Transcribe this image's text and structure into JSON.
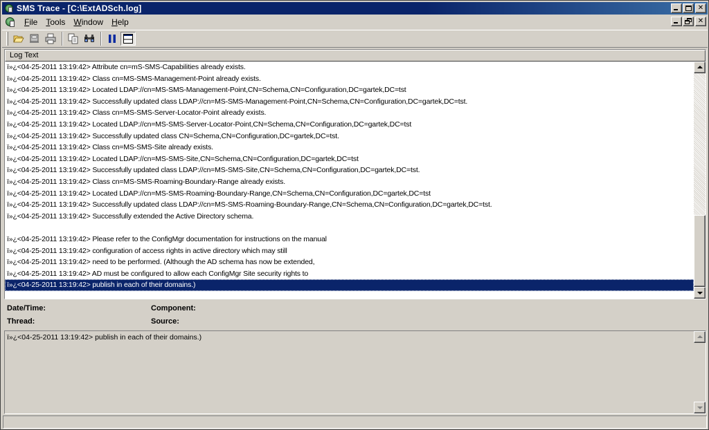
{
  "window": {
    "title": "SMS Trace - [C:\\ExtADSch.log]"
  },
  "menu": {
    "items": [
      {
        "label": "File",
        "accel": "F",
        "rest": "ile"
      },
      {
        "label": "Tools",
        "accel": "T",
        "rest": "ools"
      },
      {
        "label": "Window",
        "accel": "W",
        "rest": "indow"
      },
      {
        "label": "Help",
        "accel": "H",
        "rest": "elp"
      }
    ]
  },
  "toolbar": {
    "buttons": [
      "open-icon",
      "print-preview-icon",
      "print-icon",
      "copy-icon",
      "find-icon",
      "pause-icon",
      "detail-pane-icon"
    ]
  },
  "log": {
    "column_header": "Log Text",
    "rows": [
      "ï»¿<04-25-2011 13:19:42> Attribute cn=mS-SMS-Capabilities already exists.",
      "ï»¿<04-25-2011 13:19:42> Class cn=MS-SMS-Management-Point already exists.",
      "ï»¿<04-25-2011 13:19:42> Located LDAP://cn=MS-SMS-Management-Point,CN=Schema,CN=Configuration,DC=gartek,DC=tst",
      "ï»¿<04-25-2011 13:19:42> Successfully updated class LDAP://cn=MS-SMS-Management-Point,CN=Schema,CN=Configuration,DC=gartek,DC=tst.",
      "ï»¿<04-25-2011 13:19:42> Class cn=MS-SMS-Server-Locator-Point already exists.",
      "ï»¿<04-25-2011 13:19:42> Located LDAP://cn=MS-SMS-Server-Locator-Point,CN=Schema,CN=Configuration,DC=gartek,DC=tst",
      "ï»¿<04-25-2011 13:19:42> Successfully updated class CN=Schema,CN=Configuration,DC=gartek,DC=tst.",
      "ï»¿<04-25-2011 13:19:42> Class cn=MS-SMS-Site already exists.",
      "ï»¿<04-25-2011 13:19:42> Located LDAP://cn=MS-SMS-Site,CN=Schema,CN=Configuration,DC=gartek,DC=tst",
      "ï»¿<04-25-2011 13:19:42> Successfully updated class LDAP://cn=MS-SMS-Site,CN=Schema,CN=Configuration,DC=gartek,DC=tst.",
      "ï»¿<04-25-2011 13:19:42> Class cn=MS-SMS-Roaming-Boundary-Range already exists.",
      "ï»¿<04-25-2011 13:19:42> Located LDAP://cn=MS-SMS-Roaming-Boundary-Range,CN=Schema,CN=Configuration,DC=gartek,DC=tst",
      "ï»¿<04-25-2011 13:19:42> Successfully updated class LDAP://cn=MS-SMS-Roaming-Boundary-Range,CN=Schema,CN=Configuration,DC=gartek,DC=tst.",
      "ï»¿<04-25-2011 13:19:42> Successfully extended the Active Directory schema.",
      "",
      "ï»¿<04-25-2011 13:19:42> Please refer to the ConfigMgr documentation for instructions on the manual",
      "ï»¿<04-25-2011 13:19:42> configuration of access rights in active directory which may still",
      "ï»¿<04-25-2011 13:19:42> need to be performed.  (Although the AD schema has now be extended,",
      "ï»¿<04-25-2011 13:19:42> AD must be configured to allow each ConfigMgr Site security rights to",
      "ï»¿<04-25-2011 13:19:42> publish in each of their domains.)"
    ],
    "selected_index": 19
  },
  "details": {
    "datetime_label": "Date/Time:",
    "component_label": "Component:",
    "thread_label": "Thread:",
    "source_label": "Source:",
    "text": "ï»¿<04-25-2011 13:19:42> publish in each of their domains.)"
  },
  "colors": {
    "titlebar": "#0a246a",
    "selection": "#0a246a",
    "face": "#d4d0c8"
  }
}
